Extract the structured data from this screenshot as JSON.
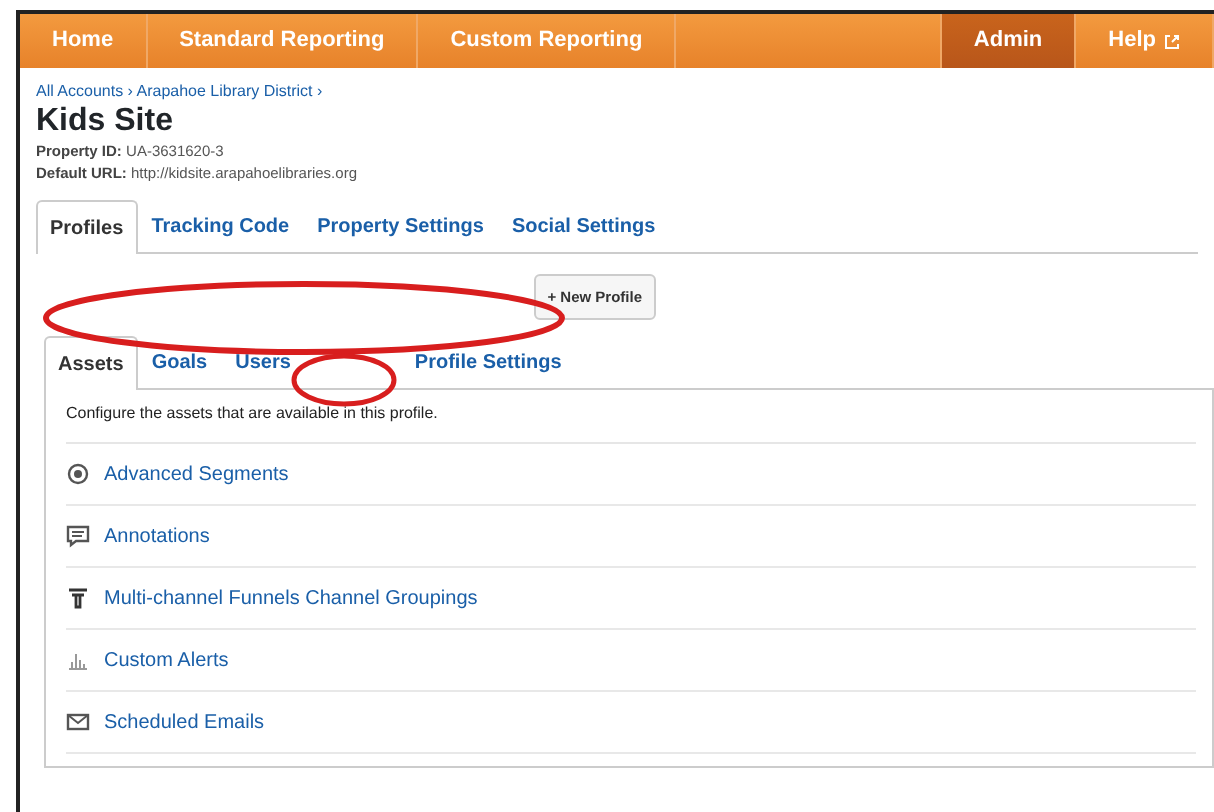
{
  "nav": {
    "left": [
      {
        "label": "Home",
        "selected": false
      },
      {
        "label": "Standard Reporting",
        "selected": false
      },
      {
        "label": "Custom Reporting",
        "selected": false
      }
    ],
    "right": [
      {
        "label": "Admin",
        "selected": true
      },
      {
        "label": "Help",
        "selected": false,
        "external": true
      }
    ]
  },
  "breadcrumb": [
    "All Accounts ›",
    "Arapahoe Library District ›"
  ],
  "title": "Kids Site",
  "meta": [
    {
      "label": "Property ID:",
      "value": "UA-3631620-3"
    },
    {
      "label": "Default URL:",
      "value": "http://kidsite.arapahoelibraries.org"
    }
  ],
  "tabs": [
    {
      "label": "Profiles",
      "selected": true
    },
    {
      "label": "Tracking Code",
      "selected": false
    },
    {
      "label": "Property Settings",
      "selected": false
    },
    {
      "label": "Social Settings",
      "selected": false
    }
  ],
  "new_profile_button": "+ New Profile",
  "profile_tabs": [
    {
      "label": "Assets",
      "selected": true
    },
    {
      "label": "Goals",
      "selected": false
    },
    {
      "label": "Users",
      "selected": false
    },
    {
      "label": "Profile Settings",
      "selected": false
    }
  ],
  "description": "Configure the assets that are available in this profile.",
  "assets": [
    {
      "label": "Advanced Segments",
      "kind": "segments"
    },
    {
      "label": "Annotations",
      "kind": "annotation"
    },
    {
      "label": "Multi-channel Funnels Channel Groupings",
      "kind": "funnel"
    },
    {
      "label": "Custom Alerts",
      "kind": "alert"
    },
    {
      "label": "Scheduled Emails",
      "kind": "email"
    }
  ]
}
